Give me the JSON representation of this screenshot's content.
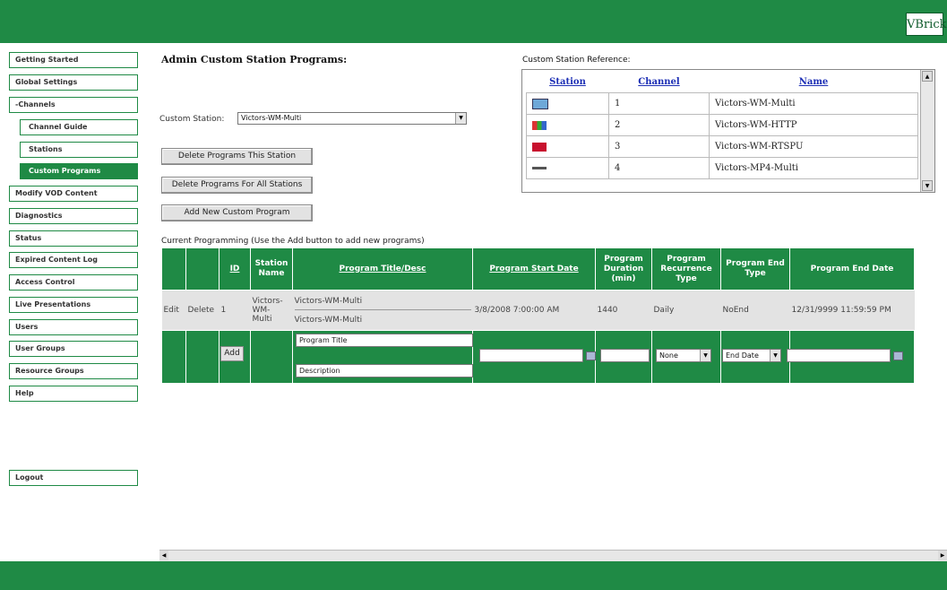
{
  "brand": {
    "logo_text": "VBrick"
  },
  "sidebar": {
    "items": [
      {
        "label": "Getting Started"
      },
      {
        "label": "Global Settings"
      },
      {
        "label": "-Channels"
      },
      {
        "label": "Channel Guide"
      },
      {
        "label": "Stations"
      },
      {
        "label": "Custom Programs"
      },
      {
        "label": "Modify VOD Content"
      },
      {
        "label": "Diagnostics"
      },
      {
        "label": "Status"
      },
      {
        "label": "Expired Content Log"
      },
      {
        "label": "Access Control"
      },
      {
        "label": "Live Presentations"
      },
      {
        "label": "Users"
      },
      {
        "label": "User Groups"
      },
      {
        "label": "Resource Groups"
      },
      {
        "label": "Help"
      }
    ],
    "logout": "Logout"
  },
  "main": {
    "title": "Admin Custom Station Programs:",
    "station_label": "Custom Station:",
    "station_value": "Victors-WM-Multi",
    "buttons": {
      "delete_station": "Delete Programs This Station",
      "delete_all": "Delete Programs For All Stations",
      "add_new": "Add New Custom Program"
    }
  },
  "reference": {
    "label": "Custom Station Reference:",
    "headers": {
      "station": "Station",
      "channel": "Channel",
      "name": "Name"
    },
    "rows": [
      {
        "channel": "1",
        "name": "Victors-WM-Multi",
        "icon": "station-logo-1-icon"
      },
      {
        "channel": "2",
        "name": "Victors-WM-HTTP",
        "icon": "station-logo-2-icon"
      },
      {
        "channel": "3",
        "name": "Victors-WM-RTSPU",
        "icon": "station-logo-3-icon"
      },
      {
        "channel": "4",
        "name": "Victors-MP4-Multi",
        "icon": "station-logo-4-icon"
      }
    ]
  },
  "programming": {
    "label": "Current Programming (Use the Add button to add new programs)",
    "headers": {
      "id": "ID",
      "station_name": "Station Name",
      "title_desc": "Program Title/Desc",
      "start_date": "Program Start Date",
      "duration": "Program Duration (min)",
      "recurrence": "Program Recurrence Type",
      "end_type": "Program End Type",
      "end_date": "Program End Date"
    },
    "row": {
      "edit": "Edit",
      "delete": "Delete",
      "id": "1",
      "station_name_line1": "Victors-",
      "station_name_line2": "WM-",
      "station_name_line3": "Multi",
      "title": "Victors-WM-Multi",
      "desc": "Victors-WM-Multi",
      "start_date": "3/8/2008 7:00:00 AM",
      "duration": "1440",
      "recurrence": "Daily",
      "end_type": "NoEnd",
      "end_date": "12/31/9999 11:59:59 PM"
    },
    "add_row": {
      "add_label": "Add",
      "title_value": "Program Title",
      "desc_value": "Description",
      "recurrence_value": "None",
      "end_type_value": "End Date"
    }
  }
}
